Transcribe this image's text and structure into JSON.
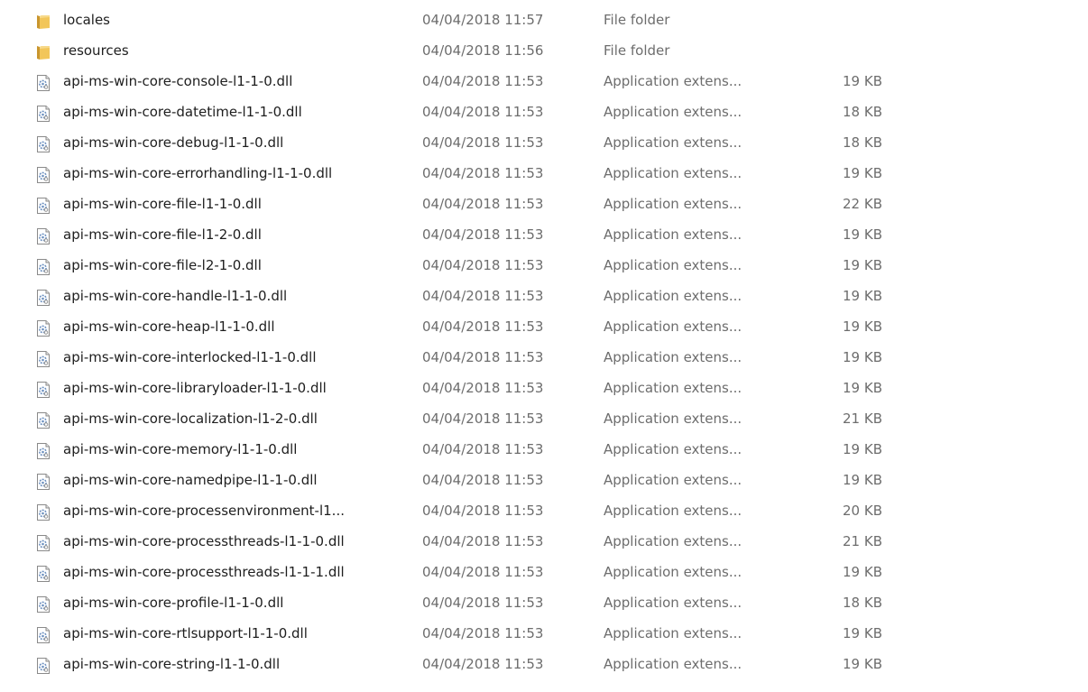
{
  "colors": {
    "name_text": "#1e1e1e",
    "detail_text": "#6d6d6d",
    "folder_yellow": "#e8b84a",
    "dll_gear_blue": "#6b8fbf"
  },
  "icons": {
    "folder": "folder-icon",
    "dll": "dll-file-icon"
  },
  "files": [
    {
      "name": "locales",
      "date": "04/04/2018 11:57",
      "type": "File folder",
      "size": "",
      "icon": "folder"
    },
    {
      "name": "resources",
      "date": "04/04/2018 11:56",
      "type": "File folder",
      "size": "",
      "icon": "folder"
    },
    {
      "name": "api-ms-win-core-console-l1-1-0.dll",
      "date": "04/04/2018 11:53",
      "type": "Application extens...",
      "size": "19 KB",
      "icon": "dll"
    },
    {
      "name": "api-ms-win-core-datetime-l1-1-0.dll",
      "date": "04/04/2018 11:53",
      "type": "Application extens...",
      "size": "18 KB",
      "icon": "dll"
    },
    {
      "name": "api-ms-win-core-debug-l1-1-0.dll",
      "date": "04/04/2018 11:53",
      "type": "Application extens...",
      "size": "18 KB",
      "icon": "dll"
    },
    {
      "name": "api-ms-win-core-errorhandling-l1-1-0.dll",
      "date": "04/04/2018 11:53",
      "type": "Application extens...",
      "size": "19 KB",
      "icon": "dll"
    },
    {
      "name": "api-ms-win-core-file-l1-1-0.dll",
      "date": "04/04/2018 11:53",
      "type": "Application extens...",
      "size": "22 KB",
      "icon": "dll"
    },
    {
      "name": "api-ms-win-core-file-l1-2-0.dll",
      "date": "04/04/2018 11:53",
      "type": "Application extens...",
      "size": "19 KB",
      "icon": "dll"
    },
    {
      "name": "api-ms-win-core-file-l2-1-0.dll",
      "date": "04/04/2018 11:53",
      "type": "Application extens...",
      "size": "19 KB",
      "icon": "dll"
    },
    {
      "name": "api-ms-win-core-handle-l1-1-0.dll",
      "date": "04/04/2018 11:53",
      "type": "Application extens...",
      "size": "19 KB",
      "icon": "dll"
    },
    {
      "name": "api-ms-win-core-heap-l1-1-0.dll",
      "date": "04/04/2018 11:53",
      "type": "Application extens...",
      "size": "19 KB",
      "icon": "dll"
    },
    {
      "name": "api-ms-win-core-interlocked-l1-1-0.dll",
      "date": "04/04/2018 11:53",
      "type": "Application extens...",
      "size": "19 KB",
      "icon": "dll"
    },
    {
      "name": "api-ms-win-core-libraryloader-l1-1-0.dll",
      "date": "04/04/2018 11:53",
      "type": "Application extens...",
      "size": "19 KB",
      "icon": "dll"
    },
    {
      "name": "api-ms-win-core-localization-l1-2-0.dll",
      "date": "04/04/2018 11:53",
      "type": "Application extens...",
      "size": "21 KB",
      "icon": "dll"
    },
    {
      "name": "api-ms-win-core-memory-l1-1-0.dll",
      "date": "04/04/2018 11:53",
      "type": "Application extens...",
      "size": "19 KB",
      "icon": "dll"
    },
    {
      "name": "api-ms-win-core-namedpipe-l1-1-0.dll",
      "date": "04/04/2018 11:53",
      "type": "Application extens...",
      "size": "19 KB",
      "icon": "dll"
    },
    {
      "name": "api-ms-win-core-processenvironment-l1...",
      "date": "04/04/2018 11:53",
      "type": "Application extens...",
      "size": "20 KB",
      "icon": "dll"
    },
    {
      "name": "api-ms-win-core-processthreads-l1-1-0.dll",
      "date": "04/04/2018 11:53",
      "type": "Application extens...",
      "size": "21 KB",
      "icon": "dll"
    },
    {
      "name": "api-ms-win-core-processthreads-l1-1-1.dll",
      "date": "04/04/2018 11:53",
      "type": "Application extens...",
      "size": "19 KB",
      "icon": "dll"
    },
    {
      "name": "api-ms-win-core-profile-l1-1-0.dll",
      "date": "04/04/2018 11:53",
      "type": "Application extens...",
      "size": "18 KB",
      "icon": "dll"
    },
    {
      "name": "api-ms-win-core-rtlsupport-l1-1-0.dll",
      "date": "04/04/2018 11:53",
      "type": "Application extens...",
      "size": "19 KB",
      "icon": "dll"
    },
    {
      "name": "api-ms-win-core-string-l1-1-0.dll",
      "date": "04/04/2018 11:53",
      "type": "Application extens...",
      "size": "19 KB",
      "icon": "dll"
    }
  ]
}
